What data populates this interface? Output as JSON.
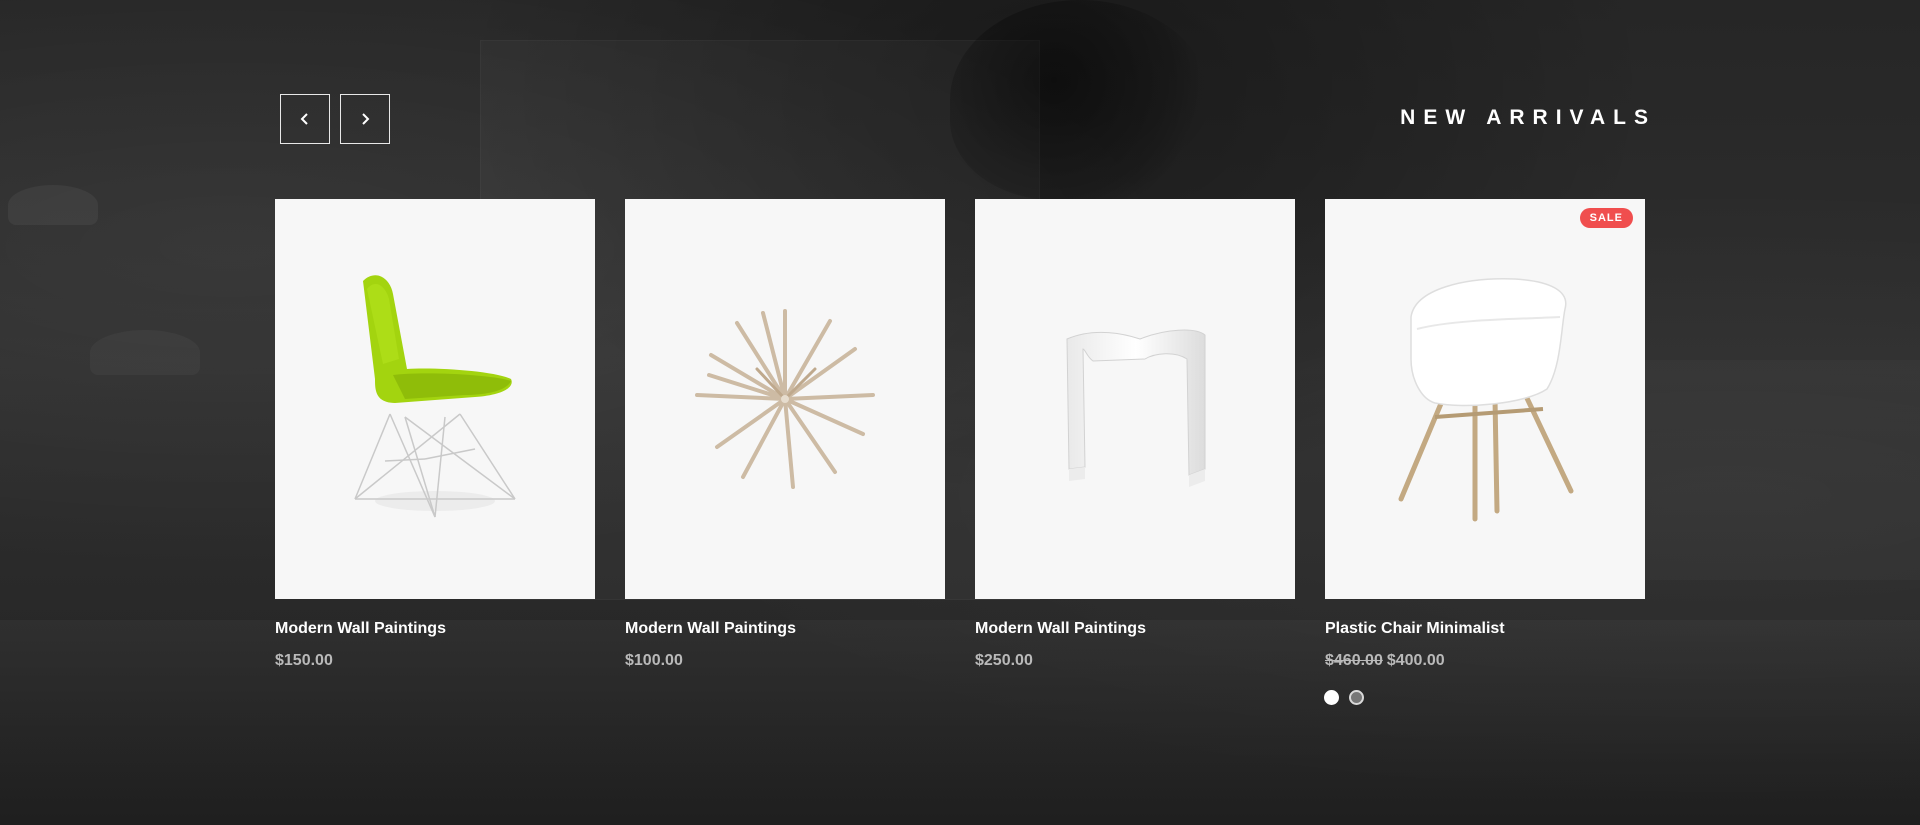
{
  "section": {
    "title": "NEW ARRIVALS"
  },
  "navigation": {
    "prev_icon": "chevron-left-icon",
    "next_icon": "chevron-right-icon"
  },
  "products": [
    {
      "name": "Modern Wall Paintings",
      "price": "$150.00",
      "image": "green-chair"
    },
    {
      "name": "Modern Wall Paintings",
      "price": "$100.00",
      "image": "starburst-clock"
    },
    {
      "name": "Modern Wall Paintings",
      "price": "$250.00",
      "image": "white-stool"
    },
    {
      "name": "Plastic Chair Minimalist",
      "old_price": "$460.00",
      "price": "$400.00",
      "badge": "SALE",
      "image": "white-chair"
    }
  ],
  "pagination": {
    "total_dots": 2,
    "active_index": 0
  },
  "colors": {
    "sale": "#f04e4e",
    "card_bg": "#f7f7f7",
    "title": "#ffffff",
    "price": "#b9b9b9",
    "chair_green": "#a3d40f"
  }
}
